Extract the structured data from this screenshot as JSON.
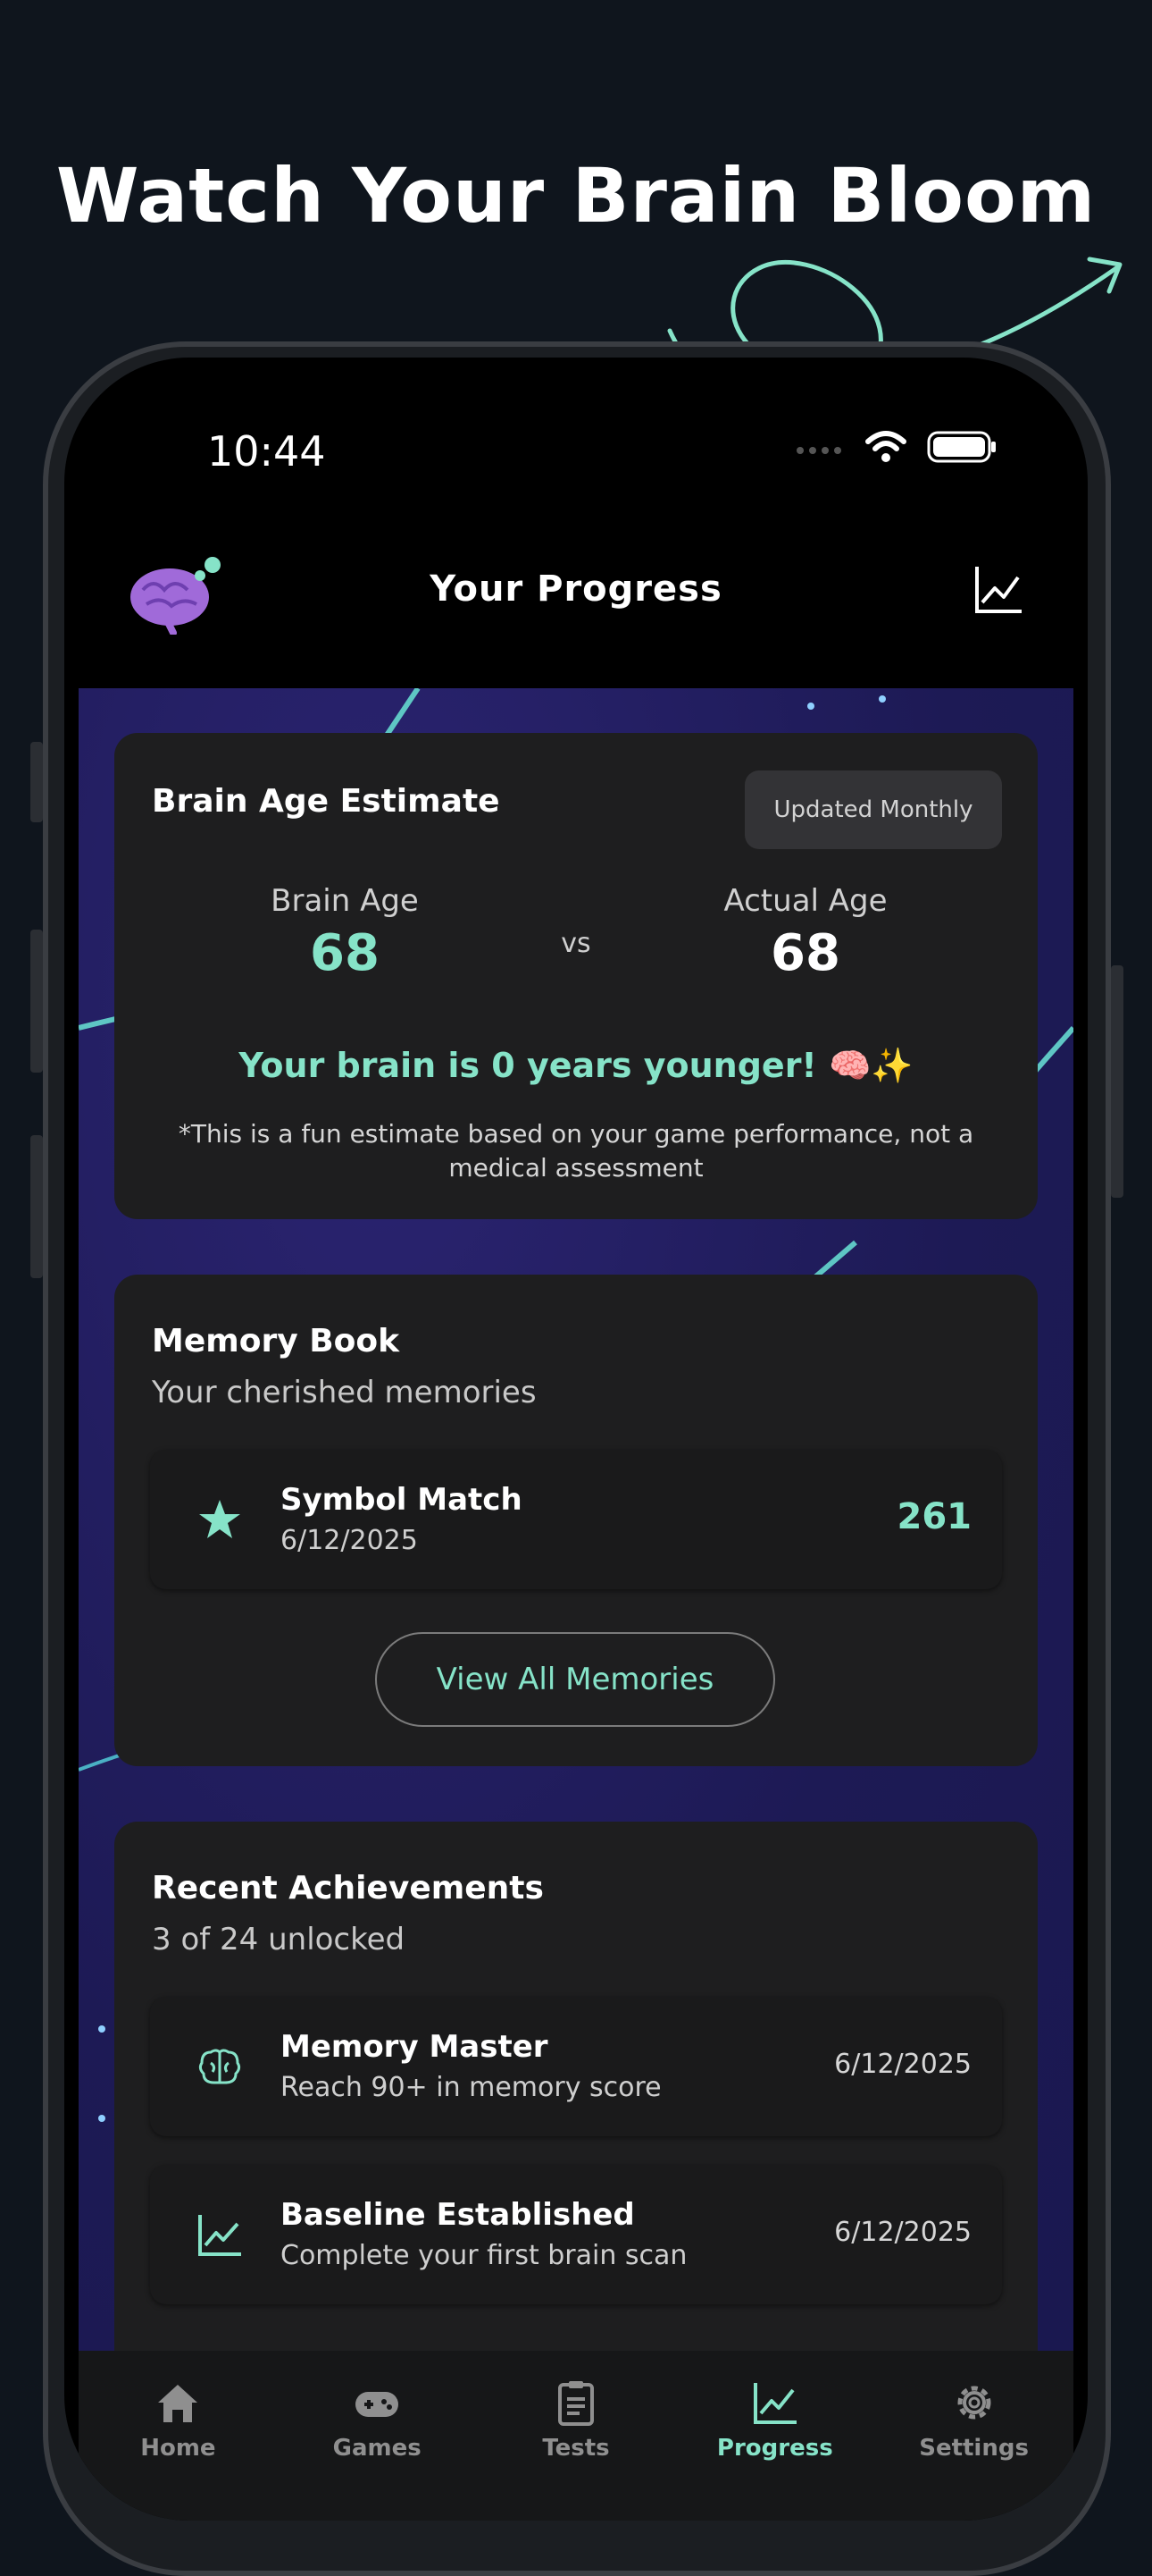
{
  "headline": "Watch Your Brain Bloom",
  "status_bar": {
    "time": "10:44"
  },
  "header": {
    "title": "Your Progress"
  },
  "brain_age": {
    "title": "Brain Age Estimate",
    "badge": "Updated Monthly",
    "brain_age_label": "Brain Age",
    "brain_age_value": "68",
    "vs": "vs",
    "actual_age_label": "Actual Age",
    "actual_age_value": "68",
    "summary": "Your brain is 0 years younger! 🧠✨",
    "disclaimer": "*This is a fun estimate based on your game performance, not a medical assessment"
  },
  "memory_book": {
    "title": "Memory Book",
    "subtitle": "Your cherished memories",
    "items": [
      {
        "title": "Symbol Match",
        "date": "6/12/2025",
        "score": "261",
        "icon": "star-icon"
      }
    ],
    "button": "View All Memories"
  },
  "achievements": {
    "title": "Recent Achievements",
    "subtitle": "3 of 24 unlocked",
    "items": [
      {
        "title": "Memory Master",
        "subtitle": "Reach 90+ in memory score",
        "date": "6/12/2025",
        "icon": "brain-icon"
      },
      {
        "title": "Baseline Established",
        "subtitle": "Complete your first brain scan",
        "date": "6/12/2025",
        "icon": "chart-icon"
      }
    ]
  },
  "tabs": [
    {
      "label": "Home",
      "icon": "home-icon"
    },
    {
      "label": "Games",
      "icon": "gamepad-icon"
    },
    {
      "label": "Tests",
      "icon": "clipboard-icon"
    },
    {
      "label": "Progress",
      "icon": "chart-icon",
      "active": true
    },
    {
      "label": "Settings",
      "icon": "gear-icon"
    }
  ],
  "colors": {
    "accent": "#86e3c8",
    "background": "#0f151d",
    "card": "#1e1e1f",
    "content_bg": "#1e1b58"
  }
}
